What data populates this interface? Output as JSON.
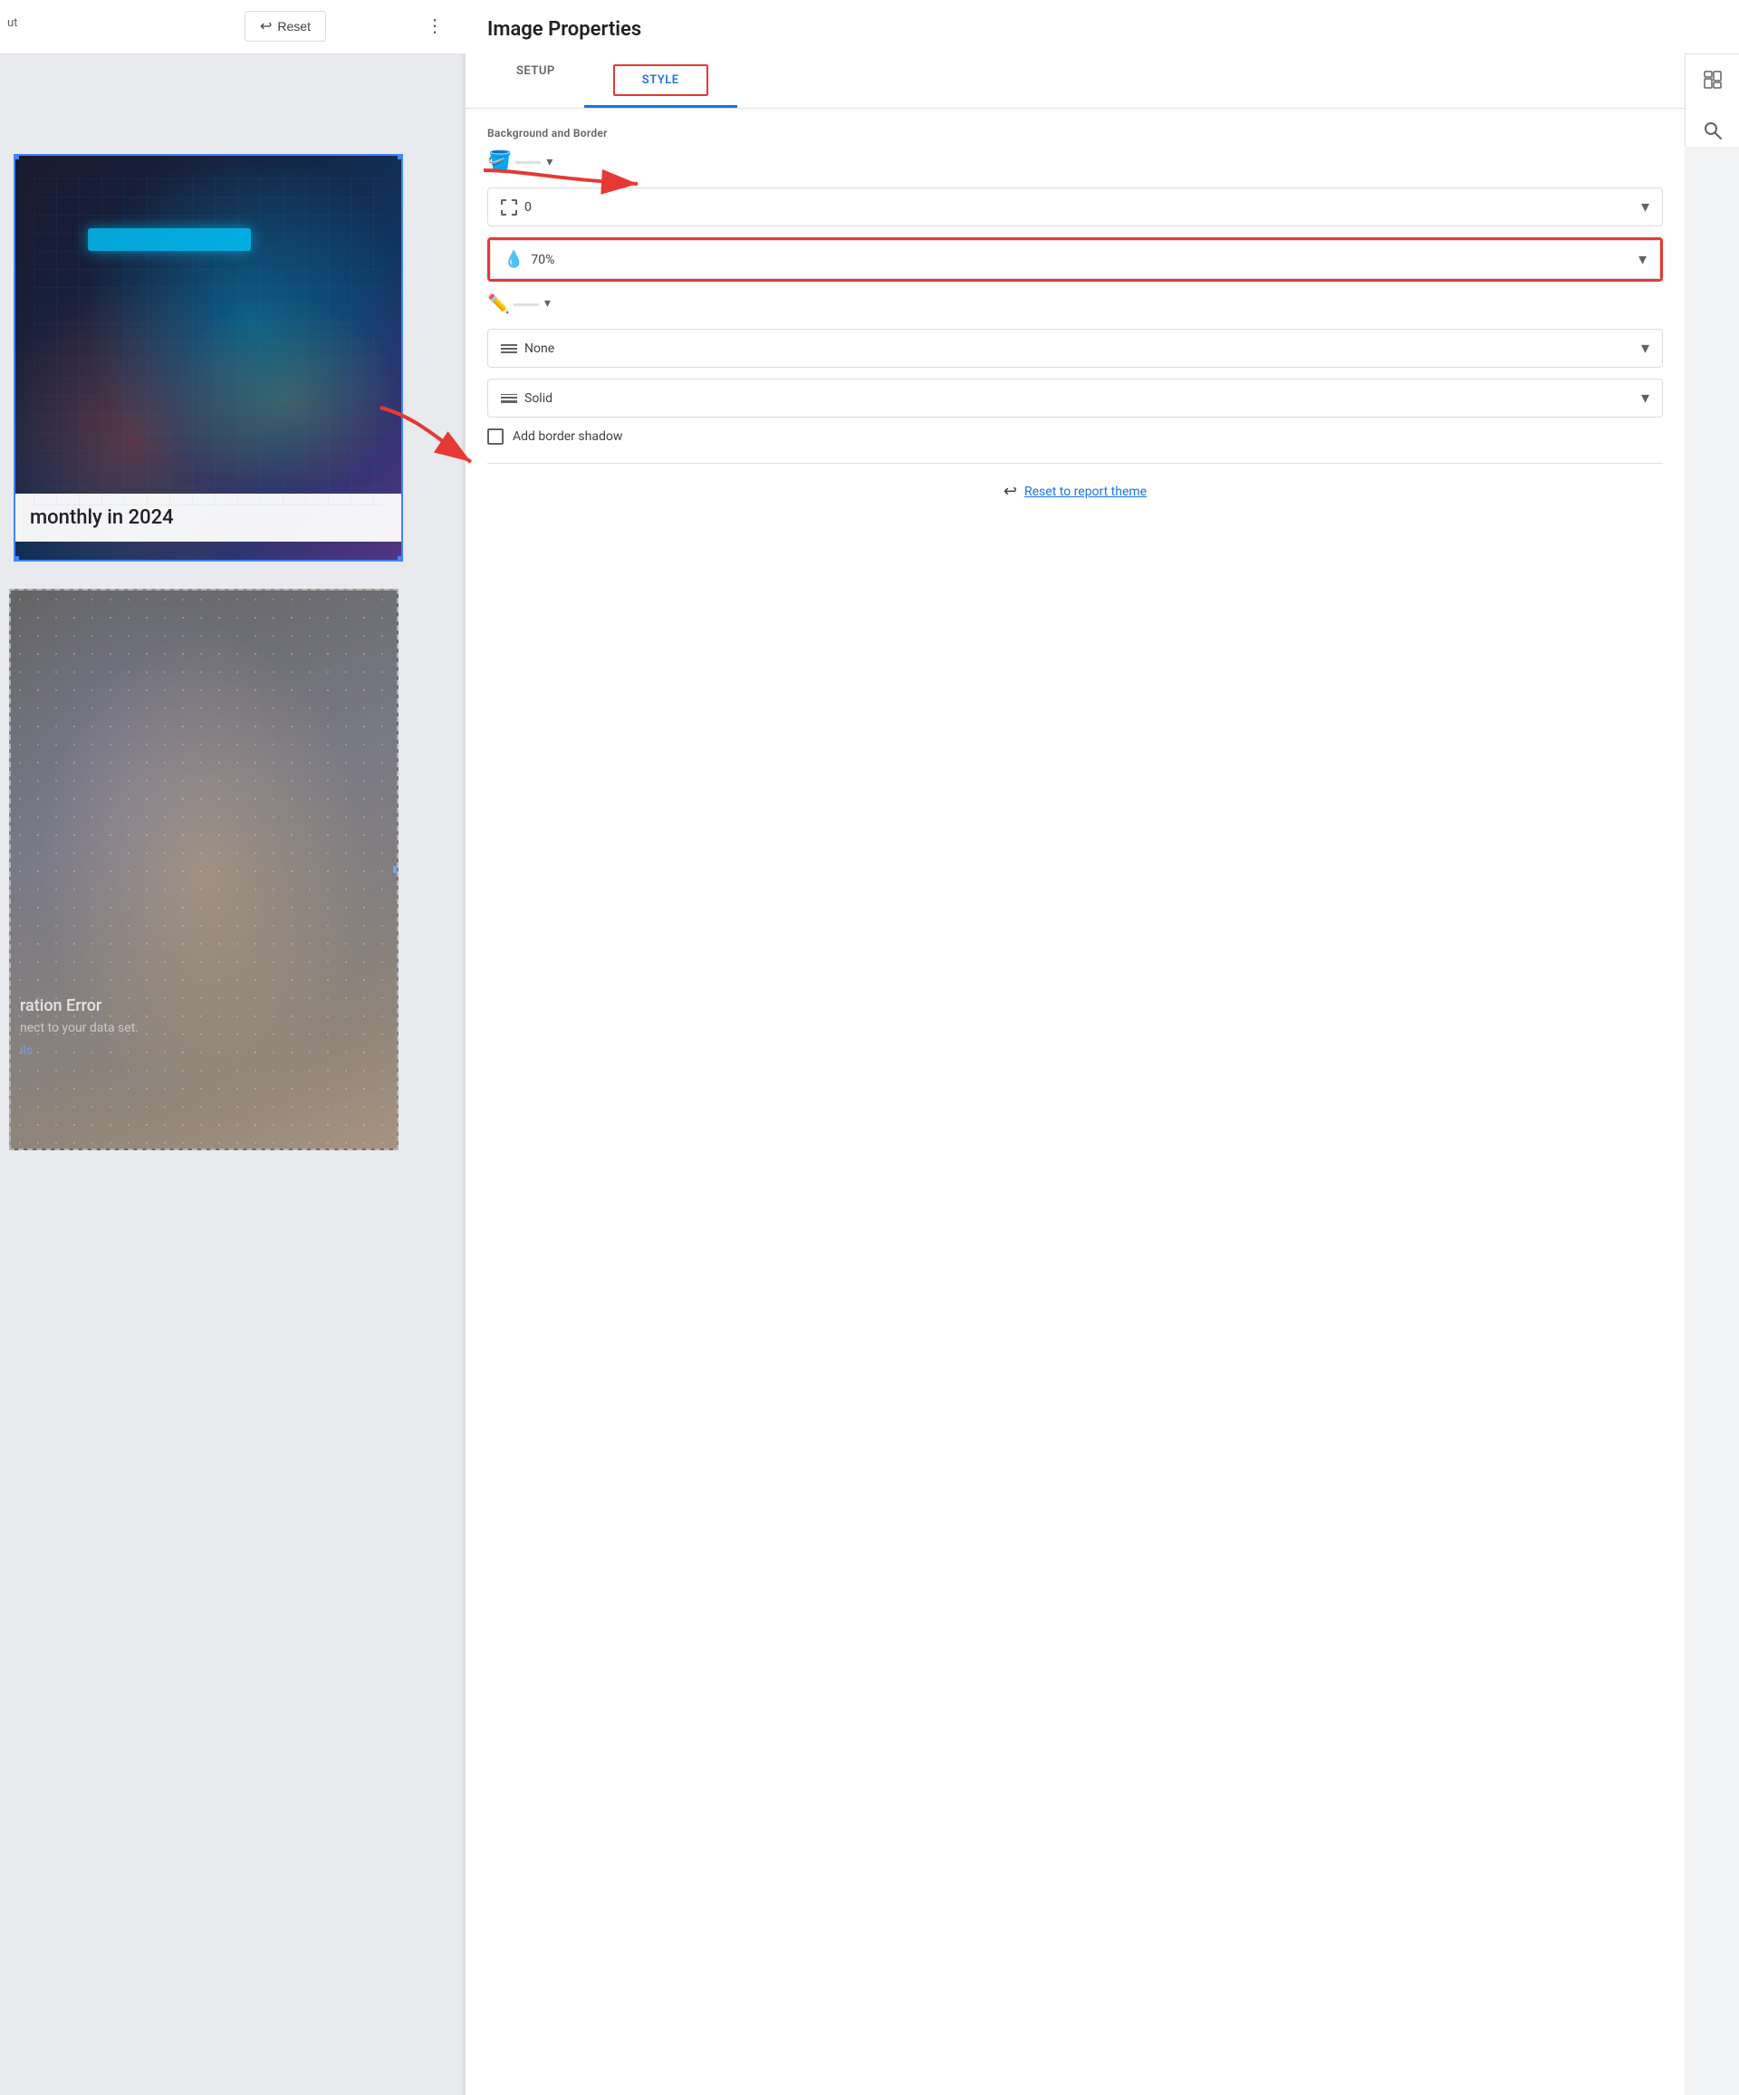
{
  "app": {
    "title": "ut"
  },
  "toolbar": {
    "reset_label": "Reset",
    "more_options_label": "⋮"
  },
  "canvas": {
    "image1_text": "monthly in 2024",
    "image2_error_title": "ration Error",
    "image2_error_desc": "nect to your data set.",
    "image2_error_link": "ils"
  },
  "panel": {
    "title": "Image Properties",
    "tabs": [
      {
        "id": "setup",
        "label": "SETUP",
        "active": false
      },
      {
        "id": "style",
        "label": "STYLE",
        "active": true
      }
    ],
    "sections": {
      "background_border": {
        "label": "Background and Border",
        "fill_color": {
          "icon": "🎨",
          "color_bar": "#e0e0e0"
        },
        "border_radius": {
          "value": "0",
          "icon": "border-radius"
        },
        "opacity": {
          "value": "70%",
          "icon": "opacity"
        },
        "stroke_color": {
          "icon": "✏️",
          "color_bar": "#e0e0e0"
        },
        "border_style": {
          "value": "None",
          "icon": "border-style"
        },
        "border_weight": {
          "value": "Solid",
          "icon": "border-weight"
        },
        "shadow": {
          "label": "Add border shadow",
          "checked": false
        }
      }
    },
    "reset_theme_label": "Reset to report theme"
  },
  "right_sidebar": {
    "data_icon": "📊",
    "search_icon": "🔍"
  },
  "annotations": {
    "arrow1_target": "STYLE tab",
    "arrow2_target": "opacity dropdown"
  }
}
